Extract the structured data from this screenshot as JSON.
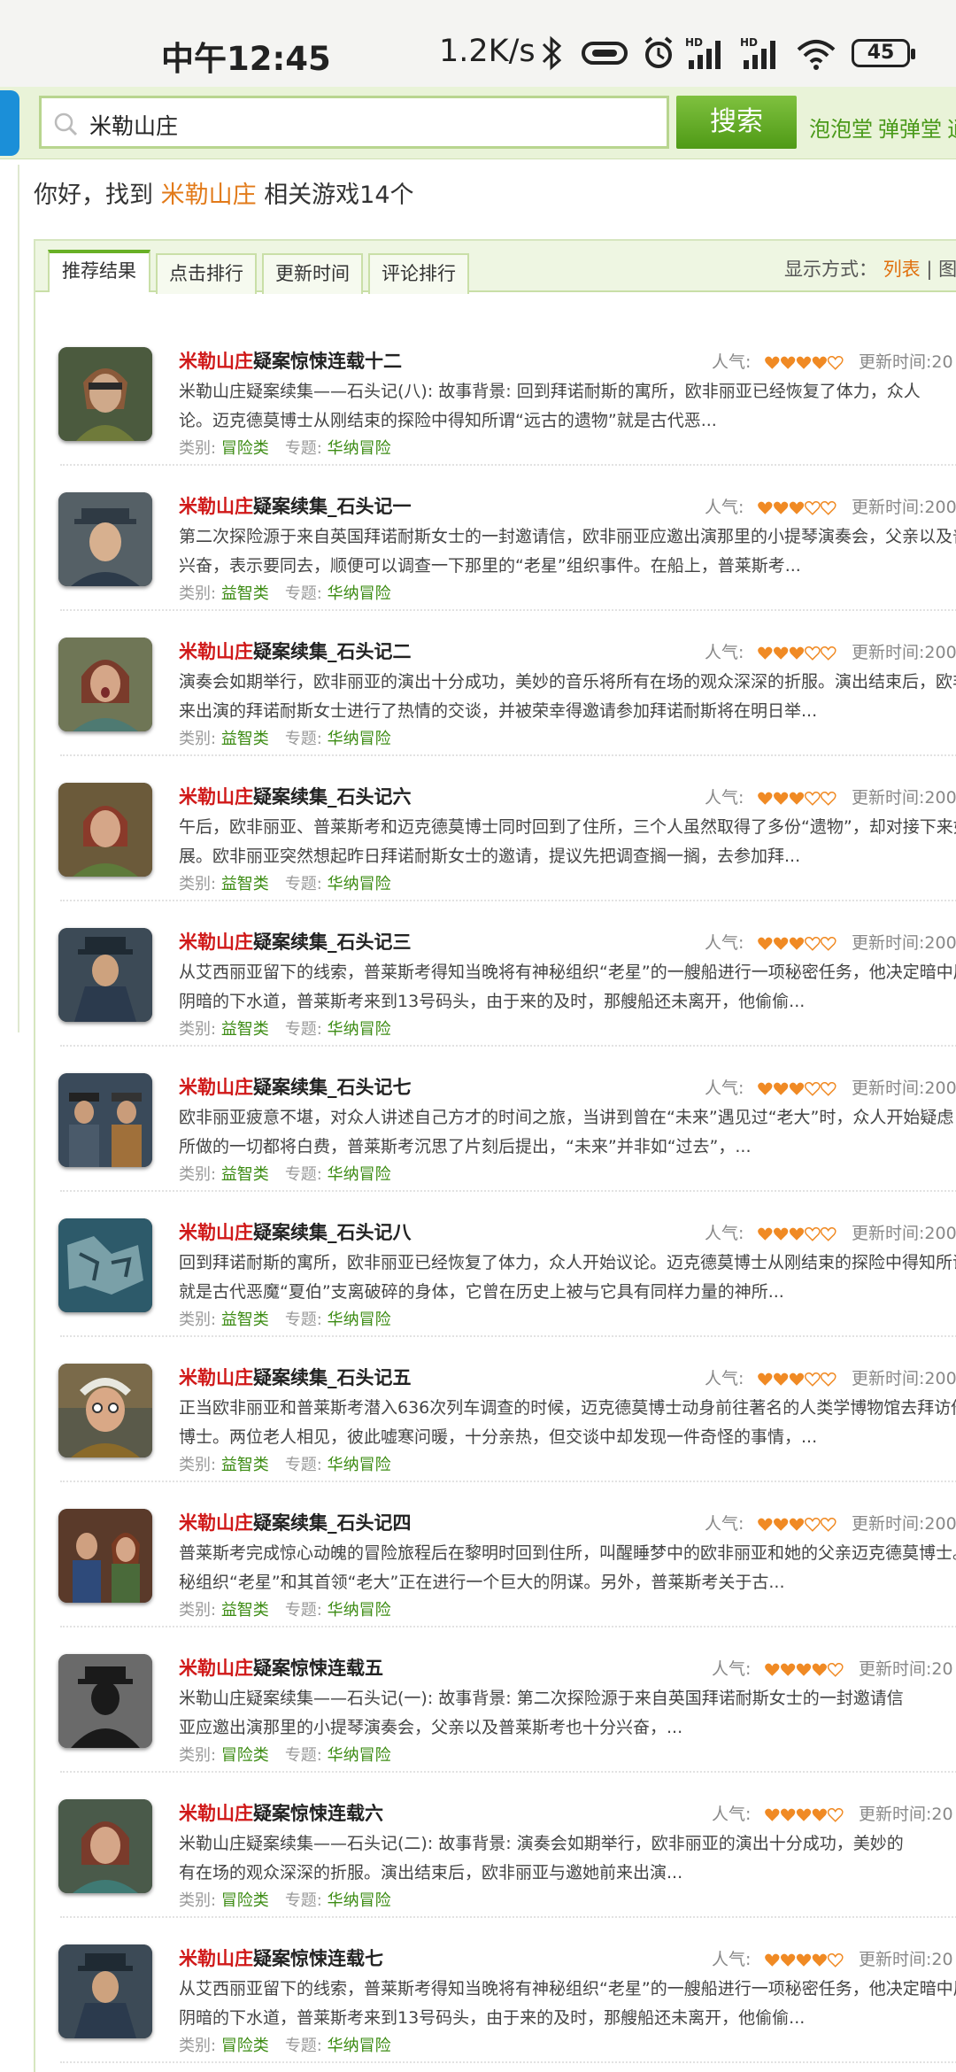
{
  "status": {
    "time": "中午12:45",
    "speed": "1.2K/s",
    "battery": "45"
  },
  "header": {
    "search_value": "米勒山庄",
    "search_button": "搜索",
    "links": [
      "泡泡堂",
      "弹弹堂",
      "逍"
    ]
  },
  "summary": {
    "prefix": "你好，找到",
    "keyword": "米勒山庄",
    "suffix": "相关游戏14个"
  },
  "tabs": [
    "推荐结果",
    "点击排行",
    "更新时间",
    "评论排行"
  ],
  "display": {
    "label": "显示方式：",
    "list": "列表",
    "sep": "|",
    "grid": "图"
  },
  "labels": {
    "popularity": "人气:",
    "category": "类别:",
    "topic": "专题:",
    "updated": "更新时间:"
  },
  "results": [
    {
      "kw": "米勒山庄",
      "rest": "疑案惊悚连载十二",
      "rating": 4,
      "upd": "20",
      "desc1": "米勒山庄疑案续集——石头记(八):          故事背景:          回到拜诺耐斯的寓所，欧非丽亚已经恢复了体力，众人",
      "desc2": "论。迈克德莫博士从刚结束的探险中得知所谓“远古的遗物”就是古代恶...",
      "cat": "冒险类",
      "topic": "华纳冒险"
    },
    {
      "kw": "米勒山庄",
      "rest": "疑案续集_石头记一",
      "rating": 3,
      "upd": "200",
      "desc1": "第二次探险源于来自英国拜诺耐斯女士的一封邀请信，欧非丽亚应邀出演那里的小提琴演奏会，父亲以及普莱斯",
      "desc2": "兴奋，表示要同去，顺便可以调查一下那里的“老星”组织事件。在船上，普莱斯考...",
      "cat": "益智类",
      "topic": "华纳冒险"
    },
    {
      "kw": "米勒山庄",
      "rest": "疑案续集_石头记二",
      "rating": 3,
      "upd": "200",
      "desc1": "演奏会如期举行，欧非丽亚的演出十分成功，美妙的音乐将所有在场的观众深深的折服。演出结束后，欧非丽亚",
      "desc2": "来出演的拜诺耐斯女士进行了热情的交谈，并被荣幸得邀请参加拜诺耐斯将在明日举...",
      "cat": "益智类",
      "topic": "华纳冒险"
    },
    {
      "kw": "米勒山庄",
      "rest": "疑案续集_石头记六",
      "rating": 3,
      "upd": "200",
      "desc1": "午后，欧非丽亚、普莱斯考和迈克德莫博士同时回到了住所，三个人虽然取得了多份“遗物”，却对接下来如何行动",
      "desc2": "展。欧非丽亚突然想起昨日拜诺耐斯女士的邀请，提议先把调查搁一搁，去参加拜...",
      "cat": "益智类",
      "topic": "华纳冒险"
    },
    {
      "kw": "米勒山庄",
      "rest": "疑案续集_石头记三",
      "rating": 3,
      "upd": "200",
      "desc1": "从艾西丽亚留下的线索，普莱斯考得知当晚将有神秘组织“老星”的一艘船进行一项秘密任务，他决定暗中展开调查",
      "desc2": "阴暗的下水道，普莱斯考来到13号码头，由于来的及时，那艘船还未离开，他偷偷...",
      "cat": "益智类",
      "topic": "华纳冒险"
    },
    {
      "kw": "米勒山庄",
      "rest": "疑案续集_石头记七",
      "rating": 3,
      "upd": "200",
      "desc1": "欧非丽亚疲意不堪，对众人讲述自己方才的时间之旅，当讲到曾在“未来”遇见过“老大”时，众人开始疑虑，这是否",
      "desc2": "所做的一切都将白费，普莱斯考沉思了片刻后提出，“未来”并非如“过去”，...",
      "cat": "益智类",
      "topic": "华纳冒险"
    },
    {
      "kw": "米勒山庄",
      "rest": "疑案续集_石头记八",
      "rating": 3,
      "upd": "200",
      "desc1": "回到拜诺耐斯的寓所，欧非丽亚已经恢复了体力，众人开始议论。迈克德莫博士从刚结束的探险中得知所谓“远古",
      "desc2": "就是古代恶魔“夏伯”支离破碎的身体，它曾在历史上被与它具有同样力量的神所...",
      "cat": "益智类",
      "topic": "华纳冒险"
    },
    {
      "kw": "米勒山庄",
      "rest": "疑案续集_石头记五",
      "rating": 3,
      "upd": "200",
      "desc1": "正当欧非丽亚和普莱斯考潜入636次列车调查的时候，迈克德莫博士动身前往著名的人类学博物馆去拜访他的老友",
      "desc2": "博士。两位老人相见，彼此嘘寒问暖，十分亲热，但交谈中却发现一件奇怪的事情，...",
      "cat": "益智类",
      "topic": "华纳冒险"
    },
    {
      "kw": "米勒山庄",
      "rest": "疑案续集_石头记四",
      "rating": 3,
      "upd": "200",
      "desc1": "普莱斯考完成惊心动魄的冒险旅程后在黎明时回到住所，叫醒睡梦中的欧非丽亚和她的父亲迈克德莫博士。三人",
      "desc2": "秘组织“老星”和其首领“老大”正在进行一个巨大的阴谋。另外，普莱斯考关于古...",
      "cat": "益智类",
      "topic": "华纳冒险"
    },
    {
      "kw": "米勒山庄",
      "rest": "疑案惊悚连载五",
      "rating": 4,
      "upd": "20",
      "desc1": "米勒山庄疑案续集——石头记(一):          故事背景:          第二次探险源于来自英国拜诺耐斯女士的一封邀请信",
      "desc2": "亚应邀出演那里的小提琴演奏会，父亲以及普莱斯考也十分兴奋，...",
      "cat": "冒险类",
      "topic": "华纳冒险"
    },
    {
      "kw": "米勒山庄",
      "rest": "疑案惊悚连载六",
      "rating": 4,
      "upd": "20",
      "desc1": "米勒山庄疑案续集——石头记(二):          故事背景:          演奏会如期举行，欧非丽亚的演出十分成功，美妙的",
      "desc2": "有在场的观众深深的折服。演出结束后，欧非丽亚与邀她前来出演...",
      "cat": "冒险类",
      "topic": "华纳冒险"
    },
    {
      "kw": "米勒山庄",
      "rest": "疑案惊悚连载七",
      "rating": 4,
      "upd": "20",
      "desc1": "从艾西丽亚留下的线索，普莱斯考得知当晚将有神秘组织“老星”的一艘船进行一项秘密任务，他决定暗中展开调查",
      "desc2": "阴暗的下水道，普莱斯考来到13号码头，由于来的及时，那艘船还未离开，他偷偷...",
      "cat": "冒险类",
      "topic": "华纳冒险"
    }
  ]
}
